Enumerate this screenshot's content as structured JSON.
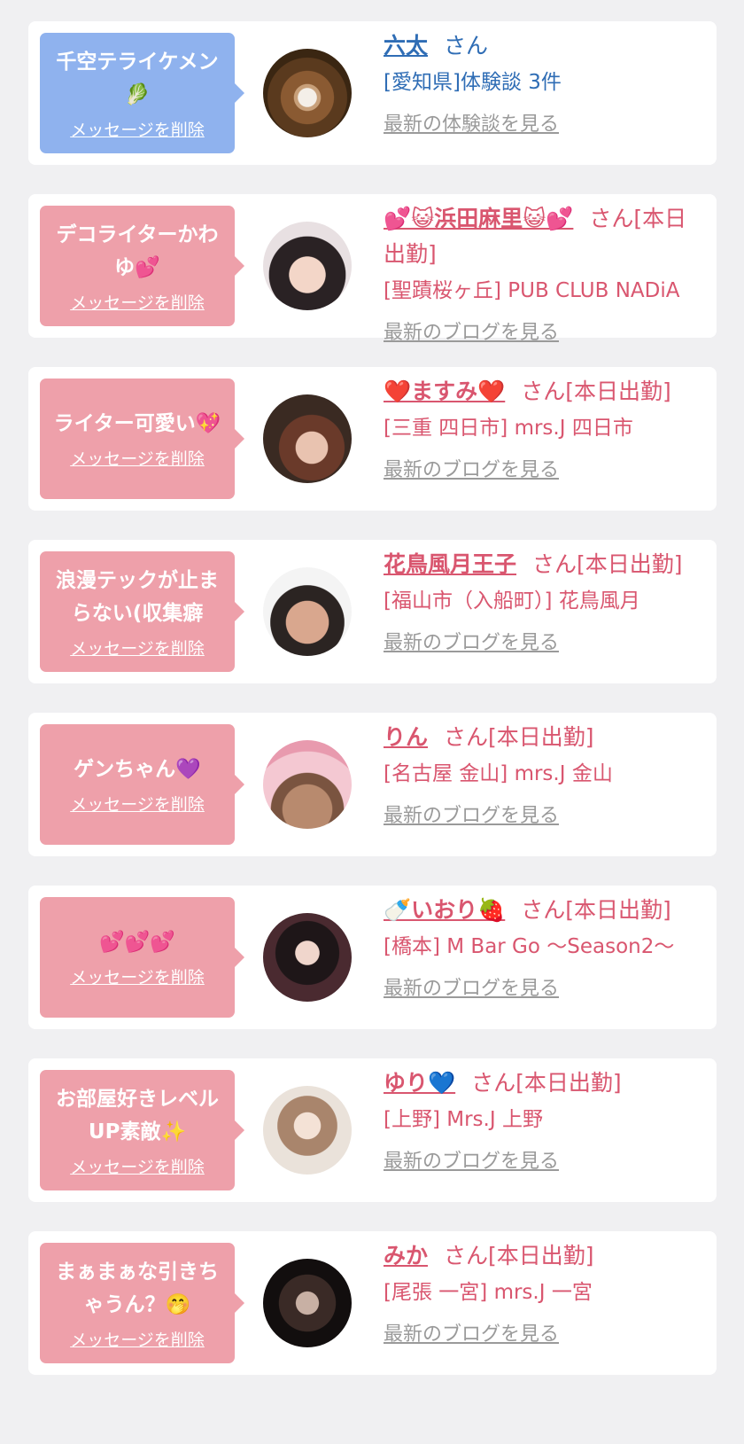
{
  "delete_label": "メッセージを削除",
  "colors": {
    "blue_bubble": "#8fb2ee",
    "pink_bubble": "#eea0aa",
    "blue_text": "#2f6db5",
    "pink_text": "#d9566f",
    "link_gray": "#9a9a9a"
  },
  "cards": [
    {
      "bubble_text": "千空テライケメン\n🥬",
      "name": "六太",
      "suffix": "さん",
      "sub": "[愛知県]体験談 3件",
      "see_more": "最新の体験談を見る"
    },
    {
      "bubble_text": "デコライターかわゆ💕",
      "name": "💕😺浜田麻里😺💕",
      "suffix": "さん[本日出勤]",
      "sub": "[聖蹟桜ヶ丘] PUB CLUB NADiA",
      "see_more": "最新のブログを見る"
    },
    {
      "bubble_text": "ライター可愛い💖",
      "name": "❤️ますみ❤️",
      "suffix": "さん[本日出勤]",
      "sub": "[三重 四日市] mrs.J 四日市",
      "see_more": "最新のブログを見る"
    },
    {
      "bubble_text": "浪漫テックが止まらない(収集癖",
      "name": "花鳥風月王子",
      "suffix": "さん[本日出勤]",
      "sub": "[福山市（入船町）] 花鳥風月",
      "see_more": "最新のブログを見る"
    },
    {
      "bubble_text": "ゲンちゃん💜",
      "name": "りん",
      "suffix": "さん[本日出勤]",
      "sub": "[名古屋 金山] mrs.J 金山",
      "see_more": "最新のブログを見る"
    },
    {
      "bubble_text": "💕💕💕",
      "name": "🍼いおり🍓",
      "suffix": "さん[本日出勤]",
      "sub": "[橋本] M Bar Go 〜Season2〜",
      "see_more": "最新のブログを見る"
    },
    {
      "bubble_text": "お部屋好きレベルUP素敵✨",
      "name": "ゆり💙",
      "suffix": "さん[本日出勤]",
      "sub": "[上野] Mrs.J 上野",
      "see_more": "最新のブログを見る"
    },
    {
      "bubble_text": "まぁまぁな引きちゃうん？🤭",
      "name": "みか",
      "suffix": "さん[本日出勤]",
      "sub": "[尾張 一宮] mrs.J 一宮",
      "see_more": "最新のブログを見る"
    }
  ]
}
